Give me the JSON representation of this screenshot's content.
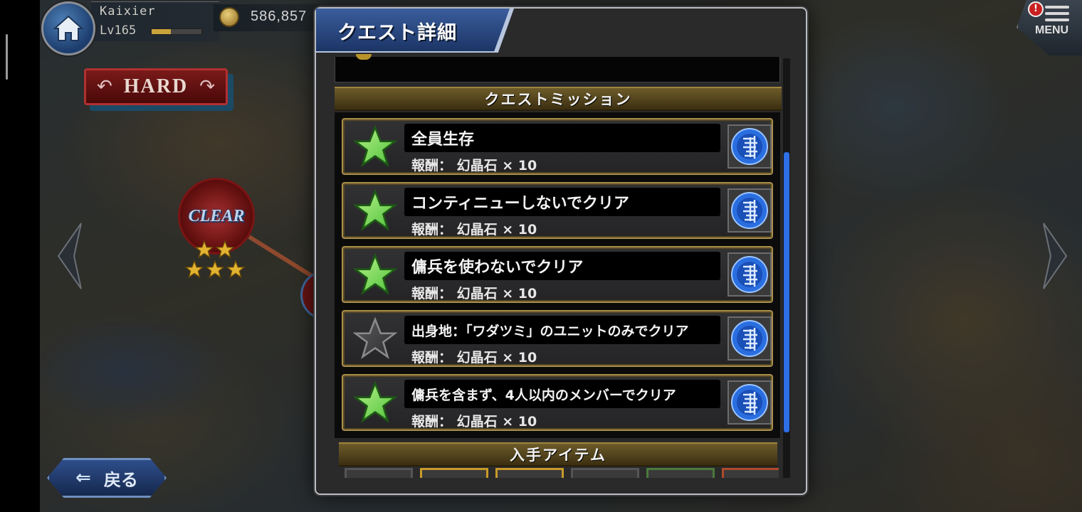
{
  "player": {
    "name": "Kaixier",
    "level": "Lv165",
    "exp_fraction": 0.38,
    "gold": "586,857"
  },
  "map": {
    "difficulty_label": "HARD",
    "clear_node_label": "CLEAR",
    "clear_node_stars": 5
  },
  "menu": {
    "label": "MENU",
    "badge": "!"
  },
  "back_button": {
    "label": "戻る"
  },
  "dialog": {
    "title": "クエスト詳細",
    "missions_header": "クエストミッション",
    "items_header": "入手アイテム",
    "missions": [
      {
        "title": "全員生存",
        "reward": "報酬： 幻晶石 × 10",
        "completed": true
      },
      {
        "title": "コンティニューしないでクリア",
        "reward": "報酬： 幻晶石 × 10",
        "completed": true
      },
      {
        "title": "傭兵を使わないでクリア",
        "reward": "報酬： 幻晶石 × 10",
        "completed": true
      },
      {
        "title": "出身地：「ワダツミ」のユニットのみでクリア",
        "reward": "報酬： 幻晶石 × 10",
        "completed": false
      },
      {
        "title": "傭兵を含まず、4人以内のメンバーでクリア",
        "reward": "報酬： 幻晶石 × 10",
        "completed": true
      }
    ],
    "item_slot_colors": [
      "#555555",
      "#c89a28",
      "#c89a28",
      "#555555",
      "#4a7a3a",
      "#b04a2a"
    ]
  },
  "colors": {
    "star_done": "#4fc23a",
    "star_todo": "#2e2e30",
    "gem": "#2a6ee0",
    "scroll_thumb": "#2e6ee6",
    "gold_border": "#a98e4c"
  }
}
